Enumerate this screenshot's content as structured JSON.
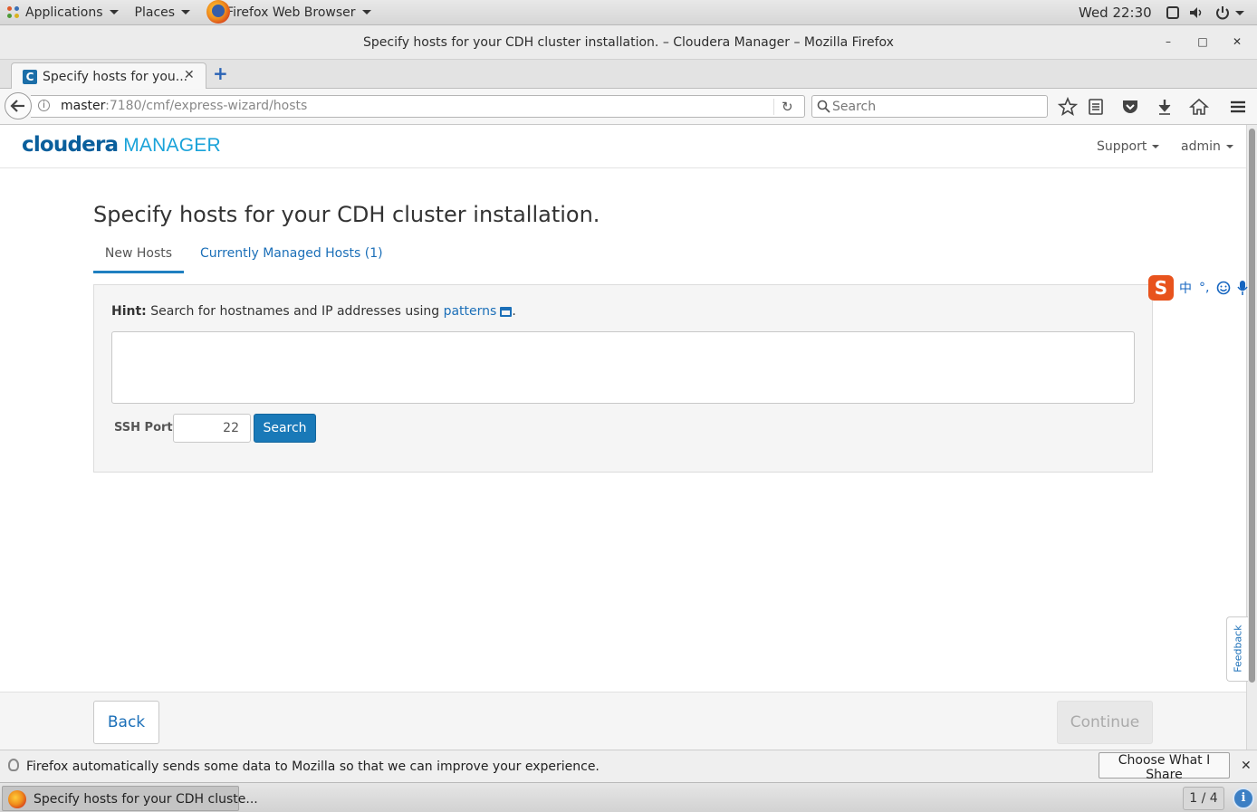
{
  "topbar": {
    "applications_label": "Applications",
    "places_label": "Places",
    "browser_label": "Firefox Web Browser",
    "clock": "Wed 22:30"
  },
  "window": {
    "title": "Specify hosts for your CDH cluster installation. – Cloudera Manager – Mozilla Firefox",
    "minimize_glyph": "–",
    "maximize_glyph": "□",
    "close_glyph": "✕"
  },
  "browser": {
    "tab_title": "Specify hosts for you...",
    "tab_favicon_letter": "C",
    "tab_close_glyph": "✕",
    "new_tab_glyph": "+",
    "url_host": "master",
    "url_rest": ":7180/cmf/express-wizard/hosts",
    "reload_glyph": "↻",
    "search_placeholder": "Search"
  },
  "cm_header": {
    "logo_primary": "cloudera",
    "logo_secondary": "MANAGER",
    "support_label": "Support",
    "admin_label": "admin"
  },
  "page": {
    "title": "Specify hosts for your CDH cluster installation.",
    "tabs": [
      {
        "label": "New Hosts",
        "active": true
      },
      {
        "label": "Currently Managed Hosts (1)",
        "active": false
      }
    ],
    "hint_label": "Hint:",
    "hint_text": "Search for hostnames and IP addresses using",
    "hint_link": "patterns",
    "hint_end": ".",
    "hosts_value": "",
    "ssh_port_label": "SSH Port:",
    "ssh_port_value": "22",
    "search_button": "Search"
  },
  "ime": {
    "logo_letter": "S",
    "mode": "中",
    "punct": "°,"
  },
  "feedback_label": "Feedback",
  "footer": {
    "back_label": "Back",
    "continue_label": "Continue"
  },
  "notification": {
    "message": "Firefox automatically sends some data to Mozilla so that we can improve your experience.",
    "button": "Choose What I Share",
    "close_glyph": "✕"
  },
  "taskbar": {
    "item_label": "Specify hosts for your CDH cluste...",
    "workspace": "1 / 4",
    "info_glyph": "i"
  },
  "colors": {
    "accent": "#1979b8",
    "link": "#1b6fb8",
    "logo_dark": "#0a5f9c",
    "logo_light": "#1aa3d9"
  }
}
